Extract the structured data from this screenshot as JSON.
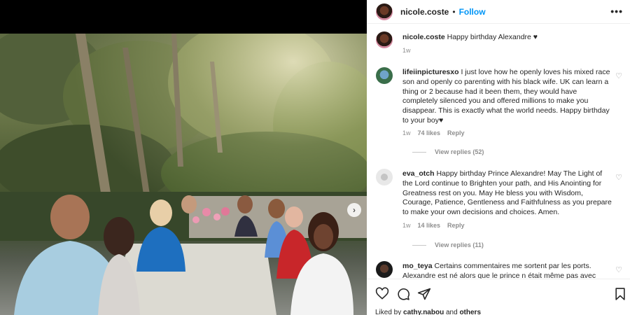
{
  "header": {
    "username": "nicole.coste",
    "dot": "•",
    "follow_label": "Follow",
    "more_icon": "more-horizontal-icon"
  },
  "media": {
    "next_icon": "chevron-right-icon",
    "next_glyph": "›"
  },
  "caption": {
    "username": "nicole.coste",
    "text": "Happy birthday Alexandre ♥",
    "time": "1w"
  },
  "comments": [
    {
      "username": "lifeiinpicturesxo",
      "text": "I just love how he openly loves his mixed race son and openly co parenting with his black wife. UK can learn a thing or 2 because had it been them, they would have completely silenced you and offered millions to make you disappear. This is exactly what the world needs. Happy birthday to your boy♥",
      "time": "1w",
      "likes": "74 likes",
      "reply": "Reply",
      "view_replies": "View replies (52)"
    },
    {
      "username": "eva_otch",
      "text": "Happy birthday Prince Alexandre! May The Light of the Lord continue to Brighten your path, and His Anointing for Greatness rest on you. May He bless you with Wisdom, Courage, Patience, Gentleness and Faithfulness as you prepare to make your own decisions and choices. Amen.",
      "time": "1w",
      "likes": "14 likes",
      "reply": "Reply",
      "view_replies": "View replies (11)"
    },
    {
      "username": "mo_teya",
      "text": "Certains commentaires me sortent par les ports. Alexandre est né alors que le prince n était même pas avec"
    }
  ],
  "liked_by": {
    "prefix": "Liked by",
    "user": "cathy.nabou",
    "and": "and",
    "others": "others"
  },
  "colors": {
    "accent": "#0095f6",
    "text": "#262626",
    "muted": "#8e8e8e"
  }
}
